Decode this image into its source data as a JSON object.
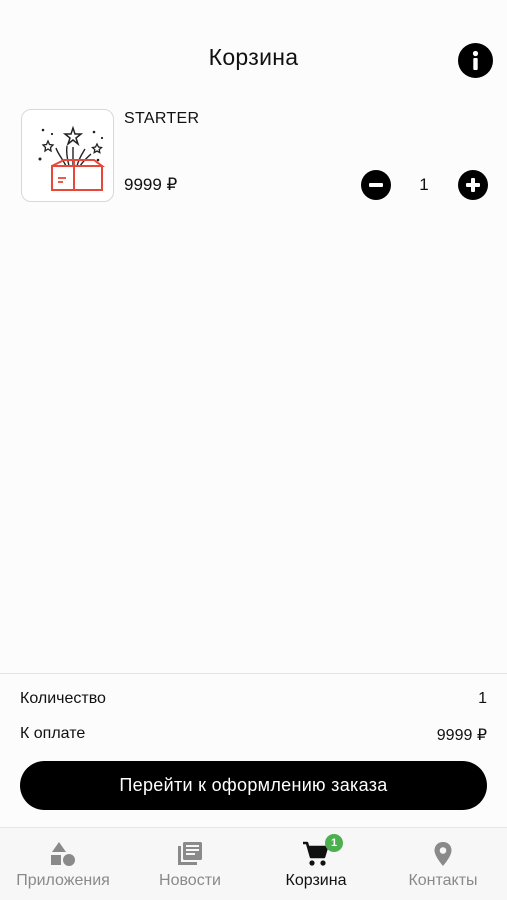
{
  "header": {
    "title": "Корзина",
    "info_icon": "info-icon"
  },
  "cart": {
    "items": [
      {
        "name": "STARTER",
        "price": "9999 ₽",
        "quantity": "1",
        "image_icon": "gift-box-fireworks-icon"
      }
    ]
  },
  "summary": {
    "quantity_label": "Количество",
    "quantity_value": "1",
    "total_label": "К оплате",
    "total_value": "9999 ₽",
    "checkout_label": "Перейти к оформлению заказа"
  },
  "tabbar": {
    "tabs": [
      {
        "label": "Приложения",
        "icon": "apps-shapes-icon",
        "active": false
      },
      {
        "label": "Новости",
        "icon": "news-icon",
        "active": false
      },
      {
        "label": "Корзина",
        "icon": "cart-icon",
        "active": true,
        "badge": "1"
      },
      {
        "label": "Контакты",
        "icon": "location-pin-icon",
        "active": false
      }
    ]
  },
  "colors": {
    "accent": "#000000",
    "badge": "#4caf50",
    "inactive": "#8a8a8a",
    "gift_box": "#e8483a"
  }
}
